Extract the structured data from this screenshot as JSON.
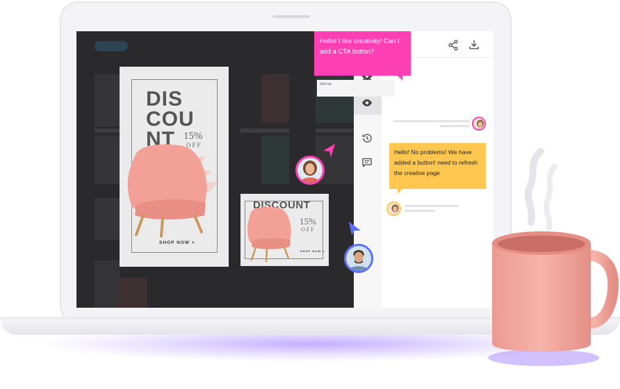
{
  "toolbar": {
    "share_icon": "share-icon",
    "download_icon": "download-icon"
  },
  "side_icons": [
    "gear-icon",
    "eye-icon",
    "history-icon",
    "comment-icon"
  ],
  "chat": {
    "msg1": "Hello! I like creativity! Can I add a CTA button?",
    "mini_label": "Click Up",
    "viewing_options": "Viewing options",
    "msg2": "Hello! No problems! We have added a button! need to refresh the creative page"
  },
  "ad_large": {
    "word1": "DIS",
    "word2": "COU",
    "word3": "NT",
    "percent": "15%",
    "off": "OFF",
    "cta": "SHOP NOW >"
  },
  "ad_small": {
    "title": "DISCOUNT",
    "percent": "15%",
    "off": "OFF",
    "cta": "SHOP NOW >"
  },
  "colors": {
    "pink": "#ff3fb4",
    "yellow": "#ffc74f",
    "blue_cursor": "#5b6cff",
    "pink_cursor": "#ff3fb4",
    "chair": "#f4a59b",
    "mug": "#f0a49c"
  }
}
